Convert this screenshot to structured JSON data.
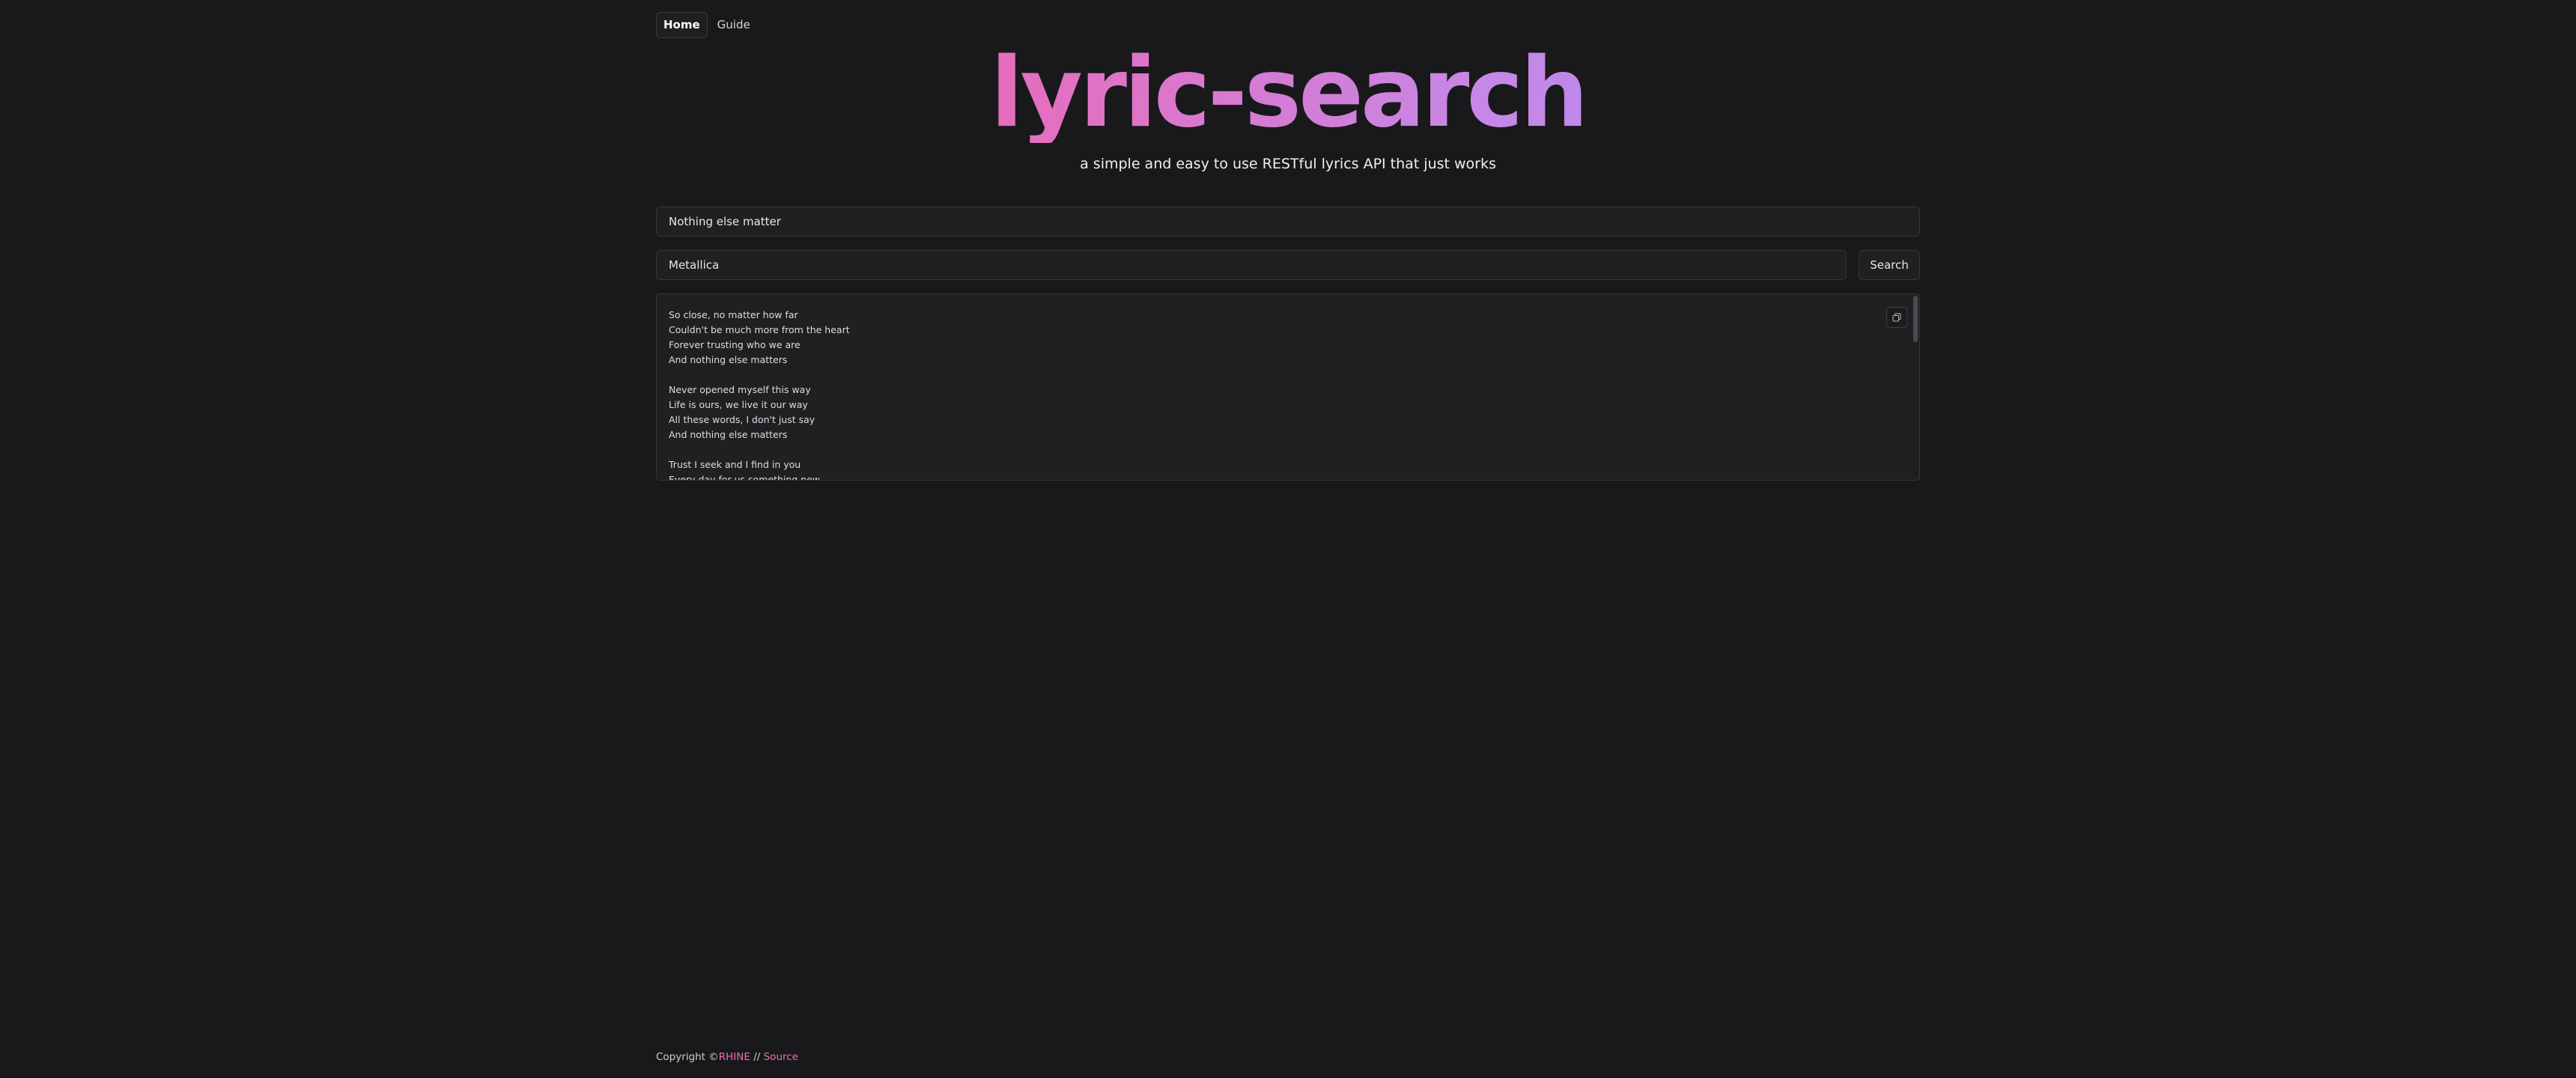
{
  "nav": {
    "items": [
      {
        "label": "Home",
        "active": true
      },
      {
        "label": "Guide",
        "active": false
      }
    ]
  },
  "hero": {
    "title": "lyric-search",
    "subtitle": "a simple and easy to use RESTful lyrics API that just works",
    "gradient_colors": [
      "#ec5fa4",
      "#a88ef7"
    ]
  },
  "search": {
    "song_value": "Nothing else matter",
    "artist_value": "Metallica",
    "button_label": "Search"
  },
  "lyrics": {
    "stanzas": [
      [
        "So close, no matter how far",
        "Couldn't be much more from the heart",
        "Forever trusting who we are",
        "And nothing else matters"
      ],
      [
        "Never opened myself this way",
        "Life is ours, we live it our way",
        "All these words, I don't just say",
        "And nothing else matters"
      ],
      [
        "Trust I seek and I find in you",
        "Every day for us something new"
      ]
    ],
    "copy_icon": "copy-icon"
  },
  "footer": {
    "prefix": "Copyright ©",
    "author": "RHINE",
    "separator": " // ",
    "source_label": "Source",
    "link_color": "#ec6fb3"
  }
}
